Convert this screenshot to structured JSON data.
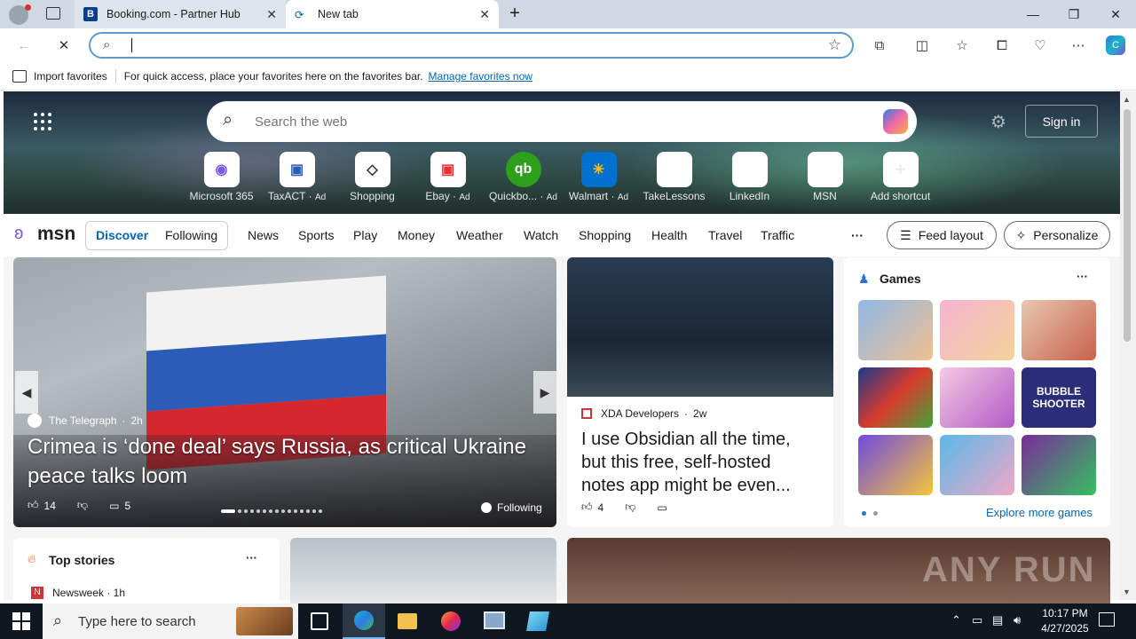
{
  "tabs": [
    {
      "title": "Booking.com - Partner Hub",
      "icon": "B"
    },
    {
      "title": "New tab"
    }
  ],
  "address": {
    "value": "",
    "placeholder": ""
  },
  "favorites_bar": {
    "import_label": "Import favorites",
    "message": "For quick access, place your favorites here on the favorites bar.",
    "manage_link": "Manage favorites now"
  },
  "hero": {
    "search_placeholder": "Search the web",
    "sign_in": "Sign in",
    "shortcuts": [
      {
        "label": "Microsoft 365",
        "ad": ""
      },
      {
        "label": "TaxACT",
        "ad": "Ad"
      },
      {
        "label": "Shopping",
        "ad": ""
      },
      {
        "label": "Ebay",
        "ad": "Ad"
      },
      {
        "label": "Quickbo...",
        "ad": "Ad"
      },
      {
        "label": "Walmart",
        "ad": "Ad"
      },
      {
        "label": "TakeLessons",
        "ad": ""
      },
      {
        "label": "LinkedIn",
        "ad": ""
      },
      {
        "label": "MSN",
        "ad": ""
      },
      {
        "label": "Add shortcut",
        "ad": ""
      }
    ]
  },
  "msn": {
    "logo": "msn",
    "tabs": [
      "Discover",
      "Following"
    ],
    "nav": [
      "News",
      "Sports",
      "Play",
      "Money",
      "Weather",
      "Watch",
      "Shopping",
      "Health",
      "Travel",
      "Traffic"
    ],
    "more": "···",
    "feed_layout": "Feed layout",
    "personalize": "Personalize"
  },
  "lead_story": {
    "source": "The Telegraph",
    "age": "2h",
    "headline_l1": "Crimea is ‘done deal’ says Russia, as critical Ukraine",
    "headline_l2": "peace talks loom",
    "likes": "14",
    "comments": "5",
    "following": "Following"
  },
  "xda_story": {
    "source": "XDA Developers",
    "age": "2w",
    "headline_l1": "I use Obsidian all the time,",
    "headline_l2": "but this free, self-hosted",
    "headline_l3": "notes app might be even...",
    "likes": "4"
  },
  "games": {
    "title": "Games",
    "more": "···",
    "explore": "Explore more games",
    "tile_text": "BUBBLE SHOOTER"
  },
  "top_stories": {
    "title": "Top stories",
    "more": "···",
    "first_source": "Newsweek · 1h"
  },
  "watermark": "ANY RUN",
  "taskbar": {
    "search_placeholder": "Type here to search",
    "time": "10:17 PM",
    "date": "4/27/2025"
  }
}
